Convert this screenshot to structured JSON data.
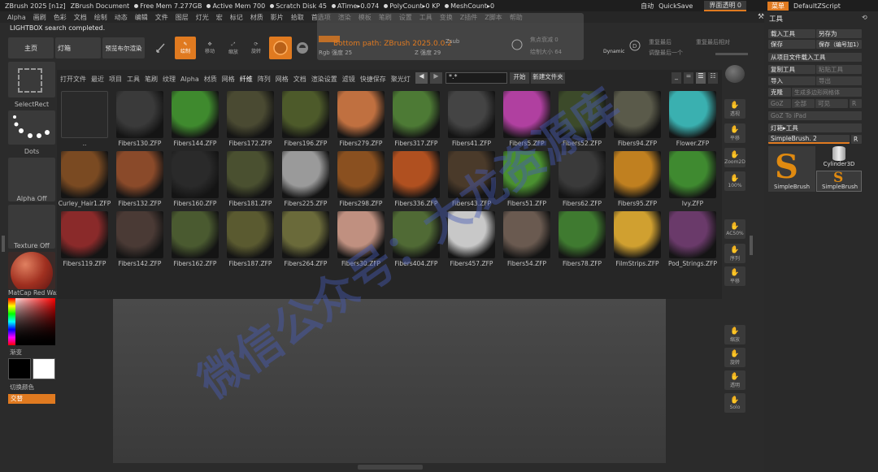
{
  "titlebar": {
    "app": "ZBrush 2025 [n1z]",
    "doc": "ZBrush Document",
    "free_mem": "Free Mem 7.277GB",
    "active_mem": "Active Mem 700",
    "scratch": "Scratch Disk 45",
    "atime": "ATime▸0.074",
    "polycount": "PolyCount▸0 KP",
    "meshcount": "MeshCount▸0",
    "auto": "自动",
    "quicksave": "QuickSave",
    "ui_opacity": "界面透明 0",
    "menu_btn": "菜单",
    "script": "DefaultZScript"
  },
  "menubar": [
    "Alpha",
    "画刷",
    "色彩",
    "文档",
    "绘制",
    "动态",
    "编辑",
    "文件",
    "图层",
    "灯光",
    "宏",
    "标记",
    "材质",
    "影片",
    "拾取",
    "首选项",
    "渲染",
    "模板",
    "笔刷",
    "设置",
    "工具",
    "变换",
    "Z插件",
    "Z脚本",
    "帮助"
  ],
  "status": "LIGHTBOX search completed.",
  "toolbar": {
    "home": "主页",
    "lightbox": "灯箱",
    "preview": "预览布尔渲染",
    "draw": "绘制",
    "move": "移动",
    "scale": "缩放",
    "rotate": "旋转",
    "popup_title": "Bottom path: ZBrush 2025.0.0.2",
    "popup_sub": "Rgb 强度 25",
    "zintensity": "Z 强度 29",
    "zsub": "Zsub",
    "focal": "焦点衰减 0",
    "draw_size": "绘制大小 64",
    "dynamic": "Dynamic",
    "last_used": "重复最后",
    "last_rel": "重复最后相对",
    "adjust": "调整最后一个"
  },
  "shelf": {
    "select_rect": "SelectRect",
    "dots": "Dots",
    "alpha_off": "Alpha Off",
    "texture_off": "Texture Off",
    "matcap": "MatCap Red Wax",
    "gradient": "渐变",
    "switch_color": "切换颜色",
    "alternate": "交替"
  },
  "lightbox": {
    "tabs": [
      "打开文件",
      "最近",
      "项目",
      "工具",
      "笔刷",
      "纹理",
      "Alpha",
      "材质",
      "网格",
      "纤维",
      "阵列",
      "网格",
      "文档",
      "渲染设置",
      "滤镜",
      "快捷保存",
      "聚光灯"
    ],
    "active_tab": 9,
    "search_value": "*.*",
    "open_btn": "开始",
    "new_folder_btn": "新建文件夹",
    "items": [
      {
        "name": "..",
        "color": "#2c2c2c"
      },
      {
        "name": "Fibers130.ZFP",
        "color": "#3a3a3a"
      },
      {
        "name": "Fibers144.ZFP",
        "color": "#3f8a2e"
      },
      {
        "name": "Fibers172.ZFP",
        "color": "#4a4a32"
      },
      {
        "name": "Fibers196.ZFP",
        "color": "#4d5a2a"
      },
      {
        "name": "Fibers279.ZFP",
        "color": "#c07040"
      },
      {
        "name": "Fibers317.ZFP",
        "color": "#4d7a35"
      },
      {
        "name": "Fibers41.ZFP",
        "color": "#444444"
      },
      {
        "name": "Fibers5.ZFP",
        "color": "#b040a0"
      },
      {
        "name": "Fibers52.ZFP",
        "color": "#3c4a2a"
      },
      {
        "name": "Fibers94.ZFP",
        "color": "#5a5a4a"
      },
      {
        "name": "Flower.ZFP",
        "color": "#3ab0b0"
      },
      {
        "name": "Curley_Hair1.ZFP",
        "color": "#7a4a22"
      },
      {
        "name": "Fibers132.ZFP",
        "color": "#8a4a2a"
      },
      {
        "name": "Fibers160.ZFP",
        "color": "#2a2a2a"
      },
      {
        "name": "Fibers181.ZFP",
        "color": "#4a5030"
      },
      {
        "name": "Fibers225.ZFP",
        "color": "#9a9a9a"
      },
      {
        "name": "Fibers298.ZFP",
        "color": "#8a5020"
      },
      {
        "name": "Fibers336.ZFP",
        "color": "#b05020"
      },
      {
        "name": "Fibers43.ZFP",
        "color": "#4a3a2a"
      },
      {
        "name": "Fibers51.ZFP",
        "color": "#4a9030"
      },
      {
        "name": "Fibers62.ZFP",
        "color": "#3a3a3a"
      },
      {
        "name": "Fibers95.ZFP",
        "color": "#c08020"
      },
      {
        "name": "Ivy.ZFP",
        "color": "#3f8a30"
      },
      {
        "name": "Fibers119.ZFP",
        "color": "#8a2a2a"
      },
      {
        "name": "Fibers142.ZFP",
        "color": "#4a3a35"
      },
      {
        "name": "Fibers162.ZFP",
        "color": "#4a5a30"
      },
      {
        "name": "Fibers187.ZFP",
        "color": "#5a5a30"
      },
      {
        "name": "Fibers264.ZFP",
        "color": "#6a6a3a"
      },
      {
        "name": "Fibers30.ZFP",
        "color": "#c09080"
      },
      {
        "name": "Fibers404.ZFP",
        "color": "#506a35"
      },
      {
        "name": "Fibers457.ZFP",
        "color": "#c8c8c8"
      },
      {
        "name": "Fibers54.ZFP",
        "color": "#6a5a50"
      },
      {
        "name": "Fibers78.ZFP",
        "color": "#3f7a30"
      },
      {
        "name": "FilmStrips.ZFP",
        "color": "#d0a030"
      },
      {
        "name": "Pod_Strings.ZFP",
        "color": "#6a3a6a"
      }
    ]
  },
  "right_toolbar": [
    "透视",
    "平移",
    "Zoom2D",
    "100%",
    "AC50%",
    "序列",
    "平移",
    "缩放",
    "旋转",
    "透明",
    "Solo"
  ],
  "toolpanel": {
    "title": "工具",
    "load": "载入工具",
    "save_as": "另存为",
    "save": "保存",
    "save_inc": "保存（编号加1）",
    "load_from_project": "从项目文件载入工具",
    "copy_tool": "复制工具",
    "paste_tool": "粘贴工具",
    "import": "导入",
    "export": "导出",
    "clone": "克隆",
    "make_poly": "生成多边形网格体",
    "goz": "GoZ",
    "all": "全部",
    "visible": "可见",
    "r": "R",
    "goz_ipad": "GoZ To iPad",
    "lightbox_tool": "灯箱▸工具",
    "current": "SimpleBrush. 2",
    "r2": "R",
    "thumb1": "SimpleBrush",
    "thumb2": "Cylinder3D",
    "thumb3": "SimpleBrush"
  },
  "watermark": "微信公众号：大龙资源库"
}
